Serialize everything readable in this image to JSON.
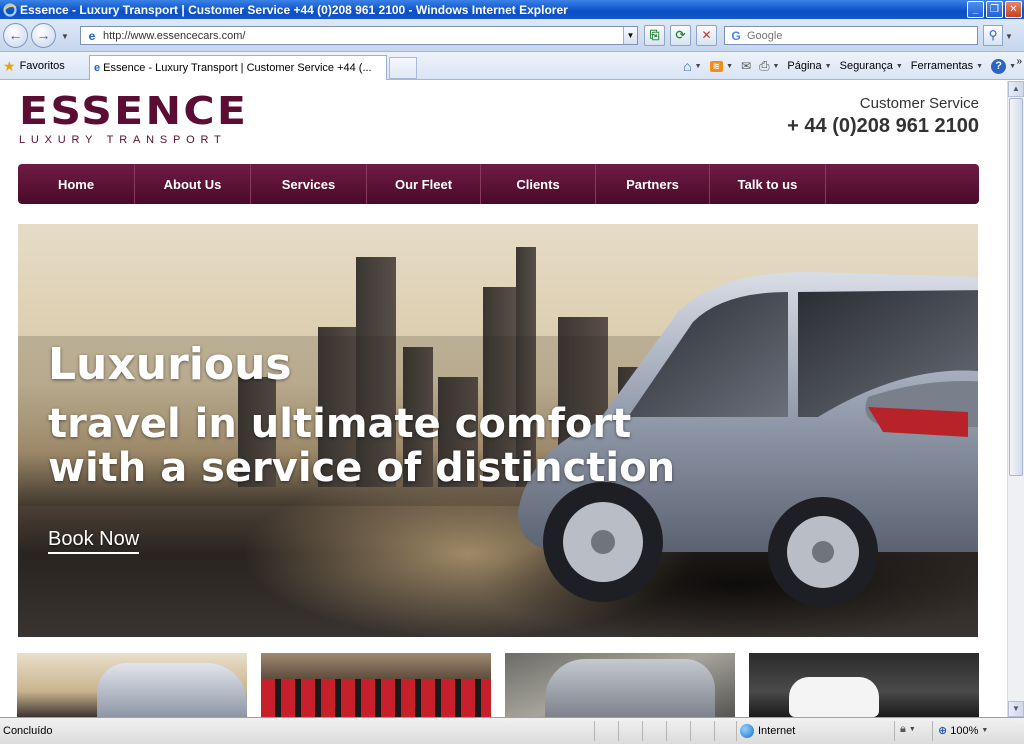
{
  "window": {
    "title": "Essence - Luxury Transport | Customer Service +44 (0)208 961 2100 - Windows Internet Explorer",
    "minimize": "_",
    "maximize": "❐",
    "close": "✕"
  },
  "addressbar": {
    "url": "http://www.essencecars.com/",
    "search_placeholder": "Google"
  },
  "commandbar": {
    "favorites_label": "Favoritos",
    "tab_title": "Essence - Luxury Transport | Customer Service +44 (...",
    "page_label": "Página",
    "security_label": "Segurança",
    "tools_label": "Ferramentas"
  },
  "site": {
    "logo_wordmark": "ESSENCE",
    "logo_tagline": "LUXURY TRANSPORT",
    "cs_label": "Customer Service",
    "cs_phone": "+ 44 (0)208 961 2100",
    "nav": [
      "Home",
      "About Us",
      "Services",
      "Our Fleet",
      "Clients",
      "Partners",
      "Talk to us"
    ],
    "hero": {
      "title": "Luxurious",
      "subtitle_line1": "travel in ultimate comfort",
      "subtitle_line2": "with a service of distinction",
      "cta": "Book Now"
    },
    "brand_color": "#5b0d33"
  },
  "statusbar": {
    "status": "Concluído",
    "zone": "Internet",
    "zoom": "100%"
  }
}
